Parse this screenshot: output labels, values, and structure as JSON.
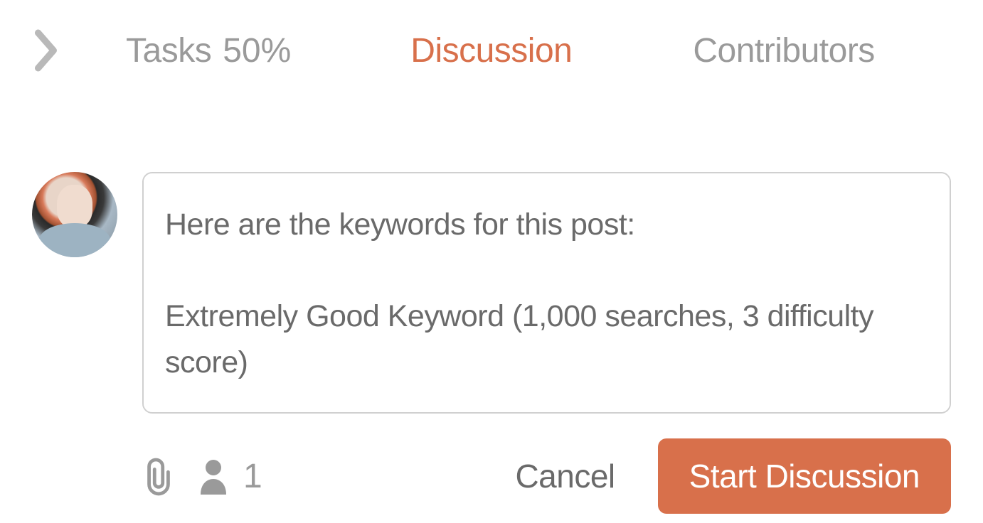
{
  "tabs": {
    "tasks_label": "Tasks",
    "tasks_percent": "50%",
    "discussion_label": "Discussion",
    "contributors_label": "Contributors"
  },
  "compose": {
    "textarea_value": "Here are the keywords for this post:\n\nExtremely Good Keyword (1,000 searches, 3 difficulty score)",
    "people_count": "1"
  },
  "actions": {
    "cancel_label": "Cancel",
    "start_label": "Start Discussion"
  }
}
